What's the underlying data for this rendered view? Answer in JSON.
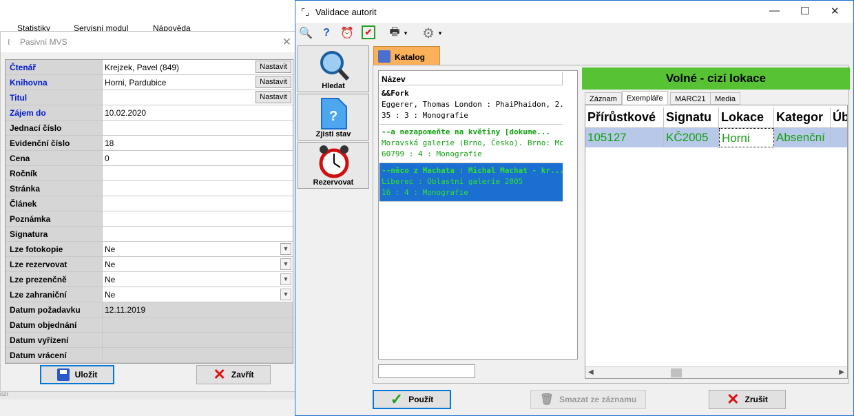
{
  "background_menu": {
    "items": [
      "Statistiky",
      "Servisní modul",
      "Nápověda"
    ]
  },
  "left_dialog": {
    "title": "Pasivní MVS",
    "rows": [
      {
        "label": "Čtenář",
        "value": "Krejzek, Pavel (849)",
        "blue": true,
        "button": "Nastavit"
      },
      {
        "label": "Knihovna",
        "value": "Horni, Pardubice",
        "blue": true,
        "button": "Nastavit"
      },
      {
        "label": "Titul",
        "value": "",
        "blue": true,
        "button": "Nastavit"
      },
      {
        "label": "Zájem do",
        "value": "10.02.2020",
        "blue": true
      },
      {
        "label": "Jednací číslo",
        "value": ""
      },
      {
        "label": "Evidenční číslo",
        "value": "18"
      },
      {
        "label": "Cena",
        "value": "0"
      },
      {
        "label": "Ročník",
        "value": ""
      },
      {
        "label": "Stránka",
        "value": ""
      },
      {
        "label": "Článek",
        "value": ""
      },
      {
        "label": "Poznámka",
        "value": ""
      },
      {
        "label": "Signatura",
        "value": ""
      },
      {
        "label": "Lze fotokopie",
        "value": "Ne",
        "dropdown": true
      },
      {
        "label": "Lze rezervovat",
        "value": "Ne",
        "dropdown": true
      },
      {
        "label": "Lze prezenčně",
        "value": "Ne",
        "dropdown": true
      },
      {
        "label": "Lze zahraniční",
        "value": "Ne",
        "dropdown": true
      },
      {
        "label": "Datum požadavku",
        "value": "12.11.2019",
        "readonly": true
      },
      {
        "label": "Datum objednání",
        "value": "",
        "readonly": true
      },
      {
        "label": "Datum vyřízení",
        "value": "",
        "readonly": true
      },
      {
        "label": "Datum vrácení",
        "value": "",
        "readonly": true
      }
    ],
    "save_label": "Uložit",
    "close_label": "Zavřít",
    "status_fragment": "ozí"
  },
  "right_dialog": {
    "title": "Validace autorit",
    "side_buttons": [
      "Hledat",
      "Zjisti stav",
      "Rezervovat"
    ],
    "catalog_tab": "Katalog",
    "list_header": "Název",
    "items": [
      {
        "l1": "&&Fork",
        "l2": "Eggerer, Thomas London : PhaiPhaidon, 2...",
        "l3": "35 : 3 : Monografie",
        "style": "normal"
      },
      {
        "l1": "--a nezapomeňte na květiny [dokume...",
        "l2": "Moravská galerie (Brno, Česko). Brno: Mor...",
        "l3": "60799 : 4 : Monografie",
        "style": "green"
      },
      {
        "l1": "--něco z Machata : Michal Machat - kr...",
        "l2": "Liberec : Oblastní galerie 2005",
        "l3": "16 : 4 : Monografie",
        "style": "selected"
      }
    ],
    "search_value": "",
    "status_banner": "Volné - cizí lokace",
    "detail_tabs": [
      "Záznam",
      "Exempláře",
      "MARC21",
      "Media"
    ],
    "active_tab": "Exempláře",
    "grid_headers": [
      "Přírůstkové",
      "Signatu",
      "Lokace",
      "Kategor",
      "Úb"
    ],
    "grid_row": [
      "105127",
      "KČ2005",
      "Horni",
      "Absenční",
      ""
    ],
    "use_label": "Použít",
    "delete_label": "Smazat ze záznamu",
    "cancel_label": "Zrušit"
  },
  "colors": {
    "status_green": "#56c234",
    "selection_blue": "#1a6fd0",
    "tab_orange": "#fbb05a",
    "label_blue": "#0018d0"
  }
}
